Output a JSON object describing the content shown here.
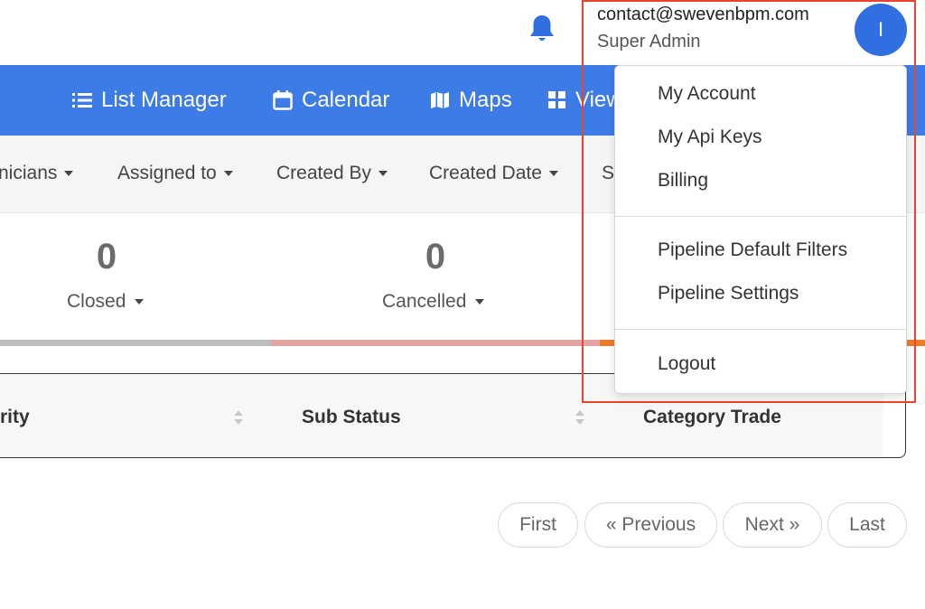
{
  "header": {
    "user_email": "contact@swevenbpm.com",
    "user_role": "Super Admin",
    "avatar_letter": "I",
    "bell_icon": "bell-icon"
  },
  "nav": {
    "items": [
      {
        "label": "List Manager",
        "icon": "list-icon"
      },
      {
        "label": "Calendar",
        "icon": "calendar-icon"
      },
      {
        "label": "Maps",
        "icon": "map-icon"
      },
      {
        "label": "View",
        "icon": "grid-icon"
      }
    ]
  },
  "filters": {
    "items": [
      "nicians",
      "Assigned to",
      "Created By",
      "Created Date",
      "S"
    ]
  },
  "stats": [
    {
      "value": "0",
      "label": "Closed"
    },
    {
      "value": "0",
      "label": "Cancelled"
    }
  ],
  "table": {
    "headers": [
      "rity",
      "Sub Status",
      "Category Trade"
    ]
  },
  "pagination": {
    "first": "First",
    "previous": "« Previous",
    "next": "Next »",
    "last": "Last"
  },
  "dropdown": {
    "items": [
      "My Account",
      "My Api Keys",
      "Billing",
      "Pipeline Default Filters",
      "Pipeline Settings",
      "Logout"
    ]
  },
  "colors": {
    "nav_bg": "#3d7be6",
    "avatar_bg": "#2f6fe0",
    "bell": "#2f6fe0",
    "bar_closed": "#bdbdbd",
    "bar_cancelled": "#e3a3a3",
    "bar_other": "#ee7d2a",
    "highlight": "#e8452c"
  }
}
